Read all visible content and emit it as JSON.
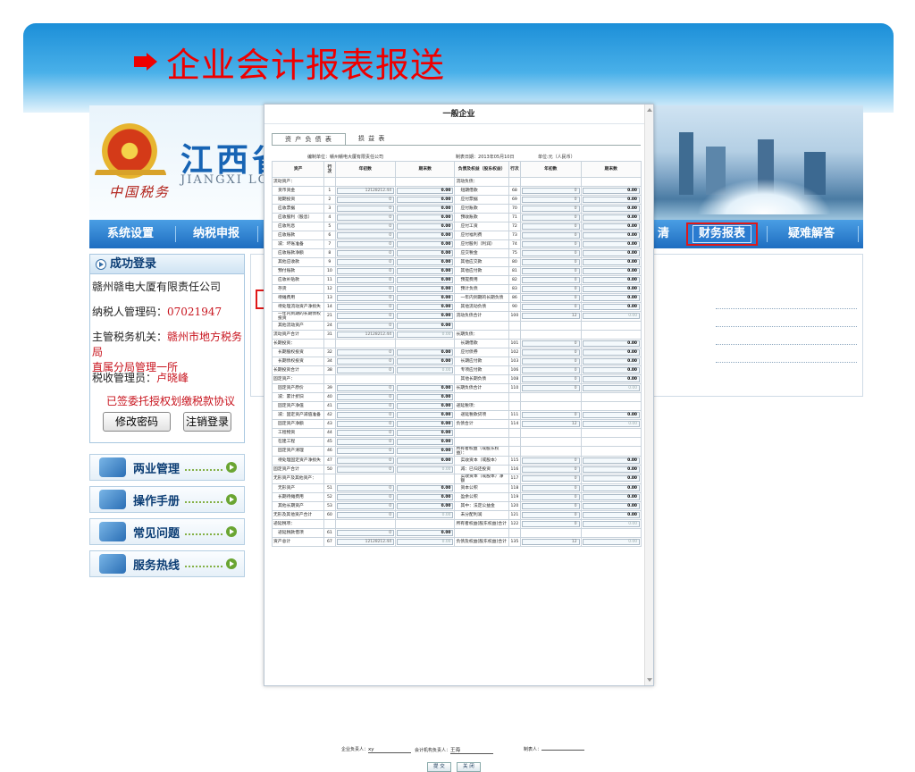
{
  "slide": {
    "title": "企业会计报表报送"
  },
  "site": {
    "logo_script": "中国税务",
    "title_cn": "江西省",
    "title_en": "JIANGXI LO",
    "nav": [
      "系统设置",
      "纳税申报",
      "财务报表",
      "疑难解答"
    ],
    "nav_partial": "清",
    "login": {
      "header": "成功登录",
      "company": "赣州赣电大厦有限责任公司",
      "mgr_label": "纳税人管理码：",
      "mgr_value": "07021947",
      "org_label": "主管税务机关：",
      "org_value_1": "赣州市地方税务局",
      "org_value_2": "直属分局管理一所",
      "officer_label": "税收管理员：",
      "officer_value": "卢晓峰",
      "notice": "已签委托授权划缴税款协议",
      "btn_change": "修改密码",
      "btn_logout": "注销登录"
    },
    "side_buttons": [
      "两业管理",
      "操作手册",
      "常见问题",
      "服务热线"
    ]
  },
  "form": {
    "title": "一般企业",
    "tabs": [
      "资 产 负 债 表",
      "损 益 表"
    ],
    "unit_label": "编制单位：",
    "unit_value": "赣州赣电大厦有限责任公司",
    "date_label": "制表日期：",
    "date_value": "2013年05月10日",
    "currency": "单位:元（人民币）",
    "headers": [
      "资产",
      "行次",
      "年初数",
      "期末数",
      "负债及权益（股东权益）",
      "行次",
      "年初数",
      "期末数"
    ],
    "rows": [
      [
        "流动资产：",
        "",
        "",
        "",
        "流动负债：",
        "",
        "",
        ""
      ],
      [
        "货币资金",
        "1",
        "12128212.44",
        "0.00",
        "短期借款",
        "68",
        "0",
        "0.00"
      ],
      [
        "短期投资",
        "2",
        "0",
        "0.00",
        "应付票据",
        "69",
        "0",
        "0.00"
      ],
      [
        "应收票据",
        "3",
        "0",
        "0.00",
        "应付账款",
        "70",
        "0",
        "0.00"
      ],
      [
        "应收股利（股息）",
        "4",
        "0",
        "0.00",
        "预收账款",
        "71",
        "0",
        "0.00"
      ],
      [
        "应收利息",
        "5",
        "0",
        "0.00",
        "应付工资",
        "72",
        "0",
        "0.00"
      ],
      [
        "应收账款",
        "6",
        "0",
        "0.00",
        "应付福利费",
        "73",
        "0",
        "0.00"
      ],
      [
        "减：坏账准备",
        "7",
        "0",
        "0.00",
        "应付股利（利润）",
        "74",
        "0",
        "0.00"
      ],
      [
        "应收账款净额",
        "8",
        "0",
        "0.00",
        "应交税金",
        "75",
        "0",
        "0.00"
      ],
      [
        "其他应收款",
        "9",
        "0",
        "0.00",
        "其他应交款",
        "80",
        "0",
        "0.00"
      ],
      [
        "预付账款",
        "10",
        "0",
        "0.00",
        "其他应付款",
        "81",
        "0",
        "0.00"
      ],
      [
        "应收补贴款",
        "11",
        "0",
        "0.00",
        "预提费用",
        "82",
        "0",
        "0.00"
      ],
      [
        "存货",
        "12",
        "0",
        "0.00",
        "预计负债",
        "83",
        "0",
        "0.00"
      ],
      [
        "待摊费用",
        "13",
        "0",
        "0.00",
        "一年内到期的长期负债",
        "86",
        "0",
        "0.00"
      ],
      [
        "待处理流动资产净损失",
        "14",
        "0",
        "0.00",
        "其他流动负债",
        "90",
        "0",
        "0.00"
      ],
      [
        "一年内到期的长期债权投资",
        "21",
        "0",
        "0.00",
        "流动负债合计",
        "100",
        "12",
        "0.00"
      ],
      [
        "其他流动资产",
        "24",
        "0",
        "0.00",
        "",
        "",
        "",
        ""
      ],
      [
        "流动资产合计",
        "31",
        "12128212.44",
        "0.00",
        "长期负债：",
        "",
        "",
        ""
      ],
      [
        "长期投资：",
        "",
        "",
        "",
        "长期借款",
        "101",
        "0",
        "0.00"
      ],
      [
        "长期股权投资",
        "32",
        "0",
        "0.00",
        "应付债券",
        "102",
        "0",
        "0.00"
      ],
      [
        "长期债权投资",
        "34",
        "0",
        "0.00",
        "长期应付款",
        "103",
        "0",
        "0.00"
      ],
      [
        "长期投资合计",
        "38",
        "0",
        "0.00",
        "专项应付款",
        "106",
        "0",
        "0.00"
      ],
      [
        "固定资产：",
        "",
        "",
        "",
        "其他长期负债",
        "108",
        "0",
        "0.00"
      ],
      [
        "固定资产原价",
        "39",
        "0",
        "0.00",
        "长期负债合计",
        "110",
        "0",
        "0.00"
      ],
      [
        "减：累计折旧",
        "40",
        "0",
        "0.00",
        "",
        "",
        "",
        ""
      ],
      [
        "固定资产净值",
        "41",
        "0",
        "0.00",
        "递延税项：",
        "",
        "",
        ""
      ],
      [
        "减：固定资产减值准备",
        "42",
        "0",
        "0.00",
        "递延税款贷项",
        "111",
        "0",
        "0.00"
      ],
      [
        "固定资产净额",
        "43",
        "0",
        "0.00",
        "负债合计",
        "114",
        "12",
        "0.00"
      ],
      [
        "工程物资",
        "44",
        "0",
        "0.00",
        "",
        "",
        "",
        ""
      ],
      [
        "在建工程",
        "45",
        "0",
        "0.00",
        "",
        "",
        "",
        ""
      ],
      [
        "固定资产清理",
        "46",
        "0",
        "0.00",
        "所有者权益（或股东权益）：",
        "",
        "",
        ""
      ],
      [
        "待处理固定资产净损失",
        "47",
        "0",
        "0.00",
        "实收资本（或股本）",
        "115",
        "0",
        "0.00"
      ],
      [
        "固定资产合计",
        "50",
        "0",
        "0.00",
        "减：已归还投资",
        "116",
        "0",
        "0.00"
      ],
      [
        "无形资产及其他资产：",
        "",
        "",
        "",
        "实收资本（或股本）净额",
        "117",
        "0",
        "0.00"
      ],
      [
        "无形资产",
        "51",
        "0",
        "0.00",
        "资本公积",
        "118",
        "0",
        "0.00"
      ],
      [
        "长期待摊费用",
        "52",
        "0",
        "0.00",
        "盈余公积",
        "119",
        "0",
        "0.00"
      ],
      [
        "其他长期资产",
        "53",
        "0",
        "0.00",
        "其中：法定公益金",
        "120",
        "0",
        "0.00"
      ],
      [
        "无形及其他资产合计",
        "60",
        "0",
        "0.00",
        "未分配利润",
        "121",
        "0",
        "0.00"
      ],
      [
        "递延税项：",
        "",
        "",
        "",
        "所有者权益(股东权益)合计",
        "122",
        "0",
        "0.00"
      ],
      [
        "递延税款借项",
        "61",
        "0",
        "0.00",
        "",
        "",
        "",
        ""
      ],
      [
        "资产总计",
        "67",
        "12128212.44",
        "0.00",
        "负债及权益(股东权益)合计",
        "135",
        "12",
        "0.00"
      ]
    ],
    "foot": {
      "leader_label": "企业负责人：",
      "leader_value": "xy",
      "acct_label": "会计机构负责人：",
      "acct_value": "王海",
      "maker_label": "制表人：",
      "maker_value": "",
      "submit": "提 交",
      "close": "关 闭"
    }
  }
}
